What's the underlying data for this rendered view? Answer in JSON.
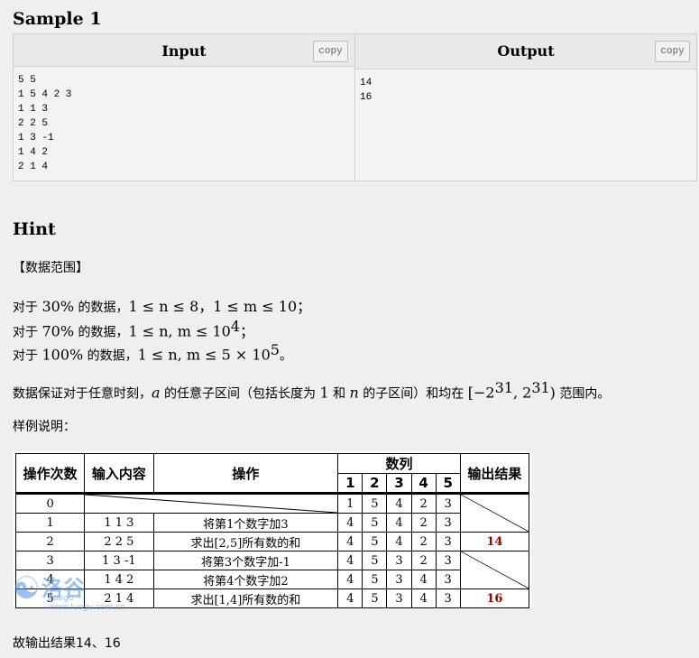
{
  "sample": {
    "title": "Sample 1",
    "input_label": "Input",
    "output_label": "Output",
    "copy_label": "copy",
    "input_text": "5 5\n1 5 4 2 3\n1 1 3\n2 2 5\n1 3 -1\n1 4 2\n2 1 4",
    "output_text": "14\n16"
  },
  "hint": {
    "title": "Hint",
    "range_heading": "【数据范围】",
    "line1_prefix": "对于 ",
    "line1_pct": "30%",
    "line1_mid": " 的数据，",
    "line1_math": "1 ≤ n ≤ 8，1 ≤ m ≤ 10；",
    "line2_pct": "70%",
    "line2_math": "1 ≤ n, m ≤ 10",
    "line2_exp": "4",
    "line2_end": "；",
    "line3_pct": "100%",
    "line3_math": "1 ≤ n, m ≤ 5 × 10",
    "line3_exp": "5",
    "line3_end": "。",
    "guarantee_a": "数据保证对于任意时刻，",
    "guarantee_var_a": "a",
    "guarantee_b": " 的任意子区间（包括长度为 ",
    "guarantee_one": "1",
    "guarantee_c": " 和 ",
    "guarantee_var_n": "n",
    "guarantee_d": " 的子区间）和均在 ",
    "guarantee_range": "[−2",
    "guarantee_exp1": "31",
    "guarantee_range2": ", 2",
    "guarantee_exp2": "31",
    "guarantee_range3": ")",
    "guarantee_e": " 范围内。",
    "example_heading": "样例说明：",
    "conclusion": "故输出结果14、16"
  },
  "table": {
    "headers": {
      "count": "操作次数",
      "input": "输入内容",
      "op": "操作",
      "seq": "数列",
      "out": "输出结果"
    },
    "seq_indices": [
      "1",
      "2",
      "3",
      "4",
      "5"
    ],
    "rows": [
      {
        "n": "0",
        "input": "",
        "op": "",
        "seq": [
          "1",
          "5",
          "4",
          "2",
          "3"
        ],
        "out": ""
      },
      {
        "n": "1",
        "input": "1 1 3",
        "op": "将第1个数字加3",
        "seq": [
          "4",
          "5",
          "4",
          "2",
          "3"
        ],
        "out": ""
      },
      {
        "n": "2",
        "input": "2 2 5",
        "op": "求出[2,5]所有数的和",
        "seq": [
          "4",
          "5",
          "4",
          "2",
          "3"
        ],
        "out": "14"
      },
      {
        "n": "3",
        "input": "1 3 -1",
        "op": "将第3个数字加-1",
        "seq": [
          "4",
          "5",
          "3",
          "2",
          "3"
        ],
        "out": ""
      },
      {
        "n": "4",
        "input": "1 4 2",
        "op": "将第4个数字加2",
        "seq": [
          "4",
          "5",
          "3",
          "4",
          "3"
        ],
        "out": ""
      },
      {
        "n": "5",
        "input": "2 1 4",
        "op": "求出[1,4]所有数的和",
        "seq": [
          "4",
          "5",
          "3",
          "4",
          "3"
        ],
        "out": "16"
      }
    ]
  },
  "watermark": {
    "text": "洛谷",
    "sub": "Luogu  www.luogu.com.cn"
  }
}
